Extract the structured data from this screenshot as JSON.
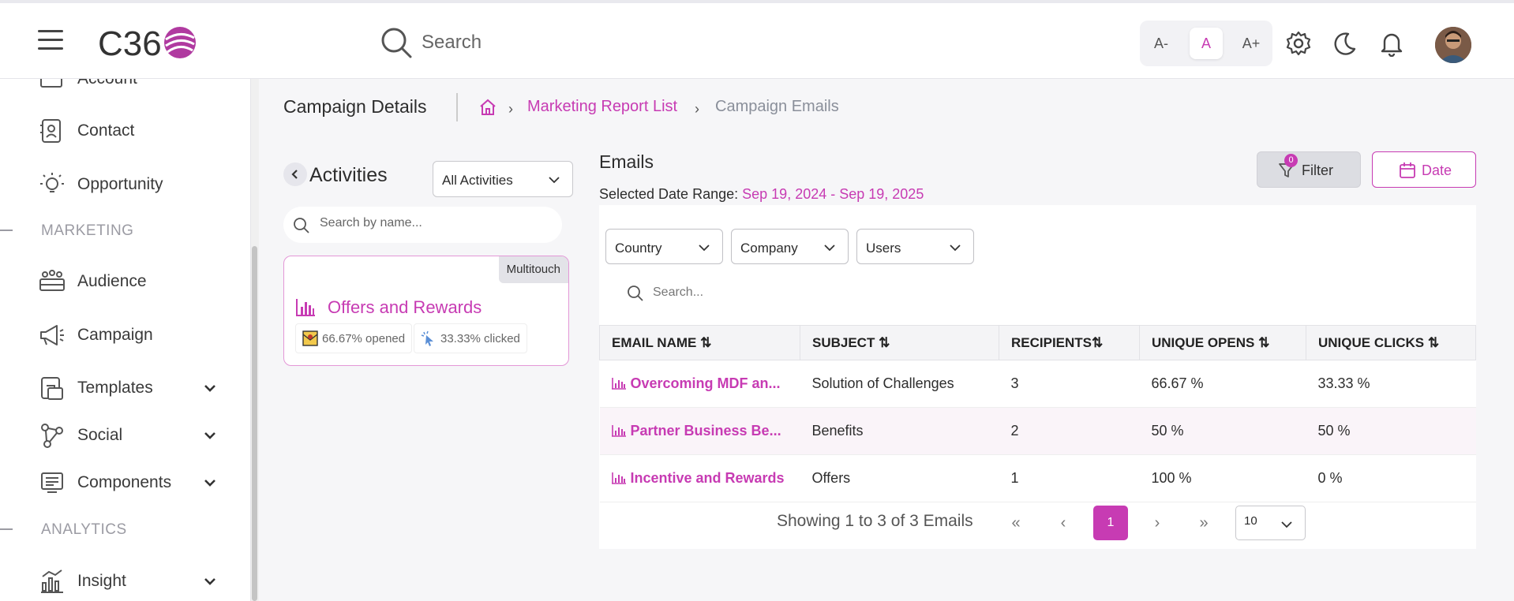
{
  "header": {
    "logo_text": "C36",
    "search_placeholder": "Search",
    "font_sizes": [
      "A-",
      "A",
      "A+"
    ],
    "font_active": "A"
  },
  "sidebar": {
    "items_top": [
      {
        "label": "Account",
        "icon": "account-icon"
      },
      {
        "label": "Contact",
        "icon": "contact-icon"
      },
      {
        "label": "Opportunity",
        "icon": "lightbulb-icon"
      }
    ],
    "section_marketing": "MARKETING",
    "items_marketing": [
      {
        "label": "Audience",
        "icon": "audience-icon"
      },
      {
        "label": "Campaign",
        "icon": "megaphone-icon"
      },
      {
        "label": "Templates",
        "icon": "templates-icon",
        "expandable": true
      },
      {
        "label": "Social",
        "icon": "social-icon",
        "expandable": true
      },
      {
        "label": "Components",
        "icon": "components-icon",
        "expandable": true
      }
    ],
    "section_analytics": "ANALYTICS",
    "items_analytics": [
      {
        "label": "Insight",
        "icon": "insight-icon",
        "expandable": true
      }
    ]
  },
  "page": {
    "title": "Campaign Details",
    "breadcrumb": {
      "link": "Marketing Report List",
      "current": "Campaign Emails"
    }
  },
  "activities": {
    "title": "Activities",
    "filter_value": "All Activities",
    "search_placeholder": "Search by name...",
    "card": {
      "badge": "Multitouch",
      "title": "Offers and Rewards",
      "opened": "66.67% opened",
      "clicked": "33.33% clicked"
    }
  },
  "emails": {
    "title": "Emails",
    "date_range_label": "Selected Date Range:",
    "date_range_value": "Sep 19, 2024 - Sep 19, 2025",
    "filter_label": "Filter",
    "filter_count": "0",
    "date_label": "Date",
    "dropdowns": [
      "Country",
      "Company",
      "Users"
    ],
    "search_placeholder": "Search...",
    "columns": [
      "EMAIL NAME",
      "SUBJECT",
      "RECIPIENTS",
      "UNIQUE OPENS",
      "UNIQUE CLICKS"
    ],
    "rows": [
      {
        "name": "Overcoming MDF an...",
        "subject": "Solution of Challenges",
        "recipients": "3",
        "opens": "66.67 %",
        "clicks": "33.33 %"
      },
      {
        "name": "Partner Business Be...",
        "subject": "Benefits",
        "recipients": "2",
        "opens": "50 %",
        "clicks": "50 %"
      },
      {
        "name": "Incentive and Rewards",
        "subject": "Offers",
        "recipients": "1",
        "opens": "100 %",
        "clicks": "0 %"
      }
    ],
    "pagination": {
      "info": "Showing 1 to 3 of 3 Emails",
      "current_page": "1",
      "per_page": "10"
    }
  },
  "colors": {
    "accent": "#c73bb3",
    "muted": "#8a8f9a"
  }
}
